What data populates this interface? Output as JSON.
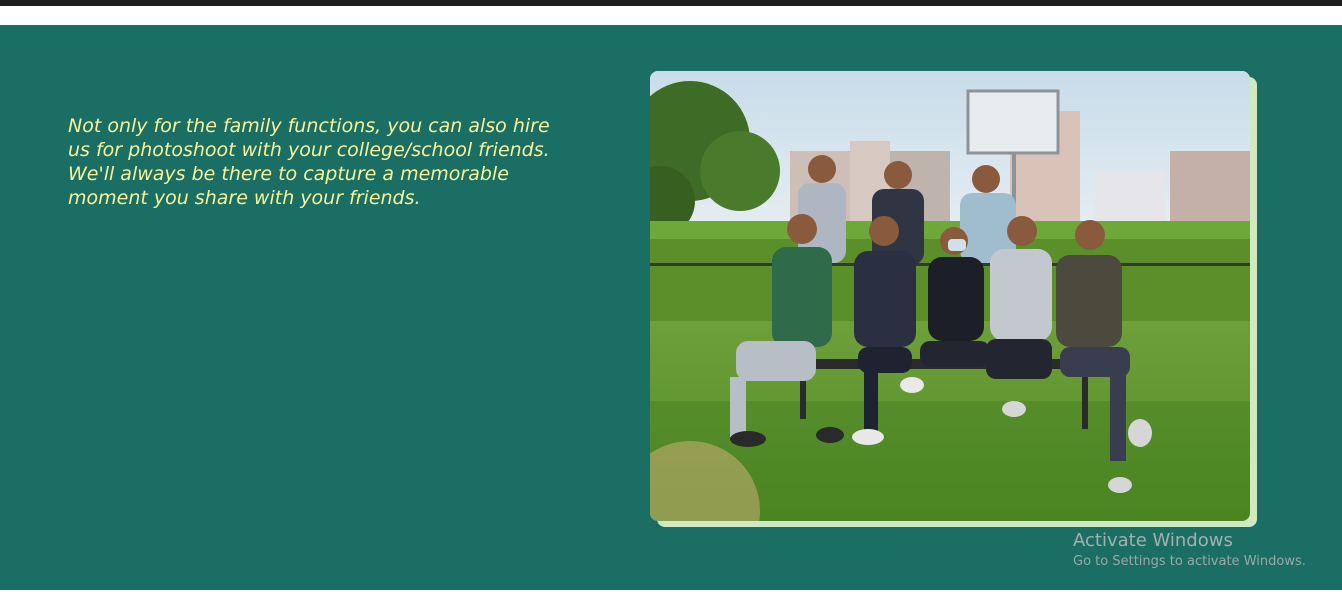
{
  "section": {
    "paragraph_1": "Not only for the family functions, you can also hire us for photoshoot with your college/school friends.",
    "paragraph_2": "We'll always be there to capture a memorable moment you share with your friends."
  },
  "photo": {
    "subject": "group photo of eight friends on a bench in a park"
  },
  "watermark": {
    "title": "Activate Windows",
    "subtitle": "Go to Settings to activate Windows."
  },
  "colors": {
    "section_bg": "#1b6e64",
    "text": "#f6f29a",
    "photo_shadow": "#cfe9c0"
  }
}
